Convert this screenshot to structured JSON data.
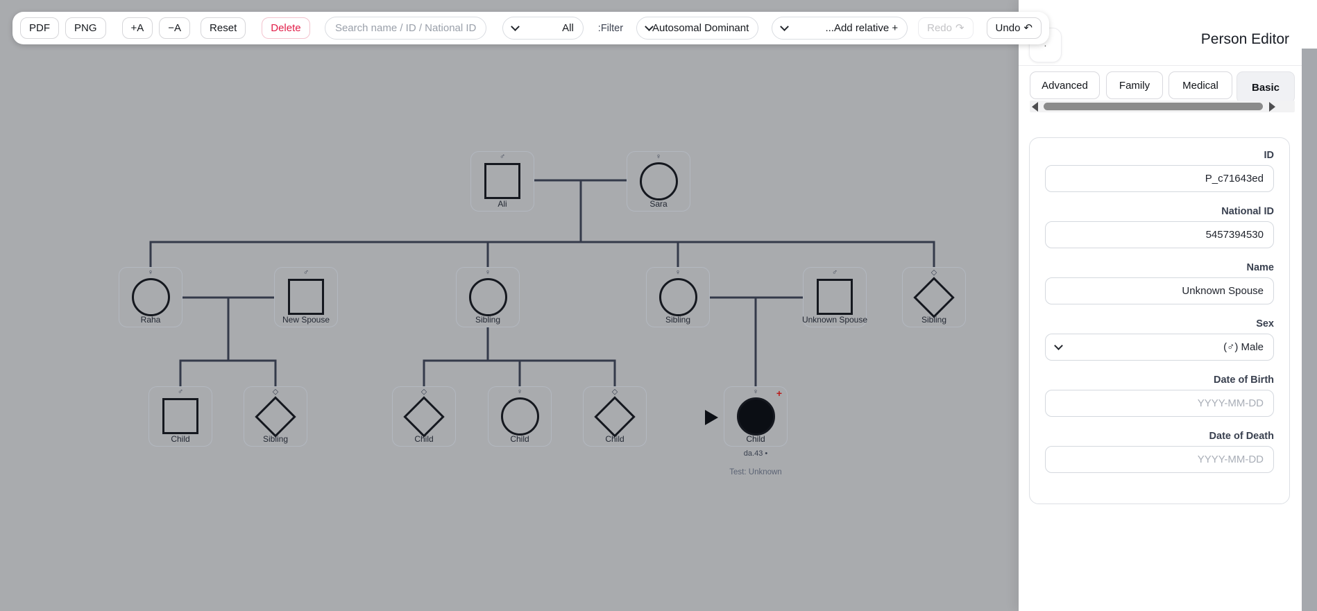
{
  "toolbar": {
    "pdf_label": "PDF",
    "png_label": "PNG",
    "font_increase_label": "+A",
    "font_decrease_label": "−A",
    "reset_label": "Reset",
    "delete_label": "Delete",
    "search_placeholder": "Search name / ID / National ID",
    "relationship_filter": {
      "value": "All"
    },
    "filter_label": ":Filter",
    "inheritance_select": {
      "value": "Autosomal Dominant"
    },
    "add_relative_select": {
      "value": "...Add relative +"
    },
    "redo": {
      "label": "Redo",
      "icon": "↷"
    },
    "undo": {
      "label": "Undo",
      "icon": "↶"
    }
  },
  "panel": {
    "title": "Person Editor",
    "collapse_glyph": "·",
    "tabs": [
      {
        "label": "Advanced"
      },
      {
        "label": "Family"
      },
      {
        "label": "Medical"
      },
      {
        "label": "Basic"
      }
    ],
    "active_tab": "Basic",
    "fields": {
      "id": {
        "label": "ID",
        "value": "P_c71643ed"
      },
      "national_id": {
        "label": "National ID",
        "value": "5457394530"
      },
      "name": {
        "label": "Name",
        "value": "Unknown Spouse"
      },
      "sex": {
        "label": "Sex",
        "value": "(♂) Male"
      },
      "dob": {
        "label": "Date of Birth",
        "placeholder": "YYYY-MM-DD"
      },
      "dod": {
        "label": "Date of Death",
        "placeholder": "YYYY-MM-DD"
      }
    }
  },
  "tree": {
    "persons": [
      {
        "label": "Ali",
        "symbol": "♂"
      },
      {
        "label": "Sara",
        "symbol": "♀"
      },
      {
        "label": "Raha",
        "symbol": "♀"
      },
      {
        "label": "New Spouse",
        "symbol": "♂"
      },
      {
        "label": "Sibling",
        "symbol": "♀"
      },
      {
        "label": "Sibling",
        "symbol": "♀"
      },
      {
        "label": "Unknown Spouse",
        "symbol": "♂"
      },
      {
        "label": "Sibling",
        "symbol": "◇"
      },
      {
        "label": "Child",
        "symbol": "♂"
      },
      {
        "label": "Sibling",
        "symbol": "◇"
      },
      {
        "label": "Child",
        "symbol": "◇"
      },
      {
        "label": "Child",
        "symbol": "♀"
      },
      {
        "label": "Child",
        "symbol": "◇"
      },
      {
        "label": "Child",
        "symbol": "♀",
        "badge": "+",
        "sublabel": "da.43 •",
        "test_status": "Test: Unknown"
      }
    ]
  },
  "colors": {
    "canvas_background": "#a9abae",
    "connector_line": "#343a4a",
    "delete_red": "#e11d48",
    "badge_red": "#b91c1c"
  }
}
